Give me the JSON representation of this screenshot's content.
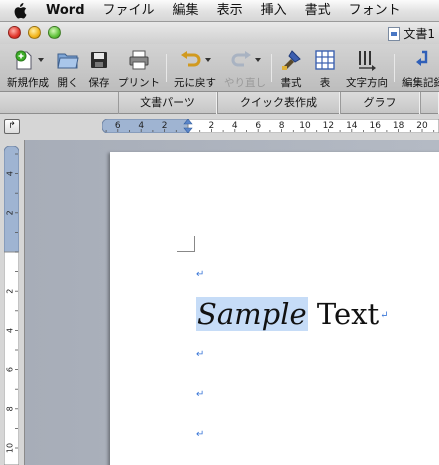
{
  "menubar": {
    "app_name": "Word",
    "items": [
      "ファイル",
      "編集",
      "表示",
      "挿入",
      "書式",
      "フォント"
    ]
  },
  "window": {
    "title": "文書1"
  },
  "toolbar": {
    "new": "新規作成",
    "open": "開く",
    "save": "保存",
    "print": "プリント",
    "undo": "元に戻す",
    "redo": "やり直し",
    "format": "書式",
    "table": "表",
    "text_direction": "文字方向",
    "edit_record": "編集記録"
  },
  "gallery_tabs": [
    "文書パーツ",
    "クイック表作成",
    "グラフ"
  ],
  "ruler": {
    "tab_selector": "↱",
    "h_numbers": [
      "6",
      "4",
      "2",
      "2",
      "4",
      "6",
      "8",
      "10",
      "12",
      "14",
      "16",
      "18",
      "20"
    ],
    "v_numbers": [
      "4",
      "2",
      "2",
      "4",
      "6",
      "8",
      "10"
    ]
  },
  "document": {
    "selected_word": "Sample",
    "rest_text": " Text",
    "paragraph_mark": "↵"
  },
  "colors": {
    "selection": "#c6dcf7",
    "paragraph_mark": "#3c78d8"
  }
}
